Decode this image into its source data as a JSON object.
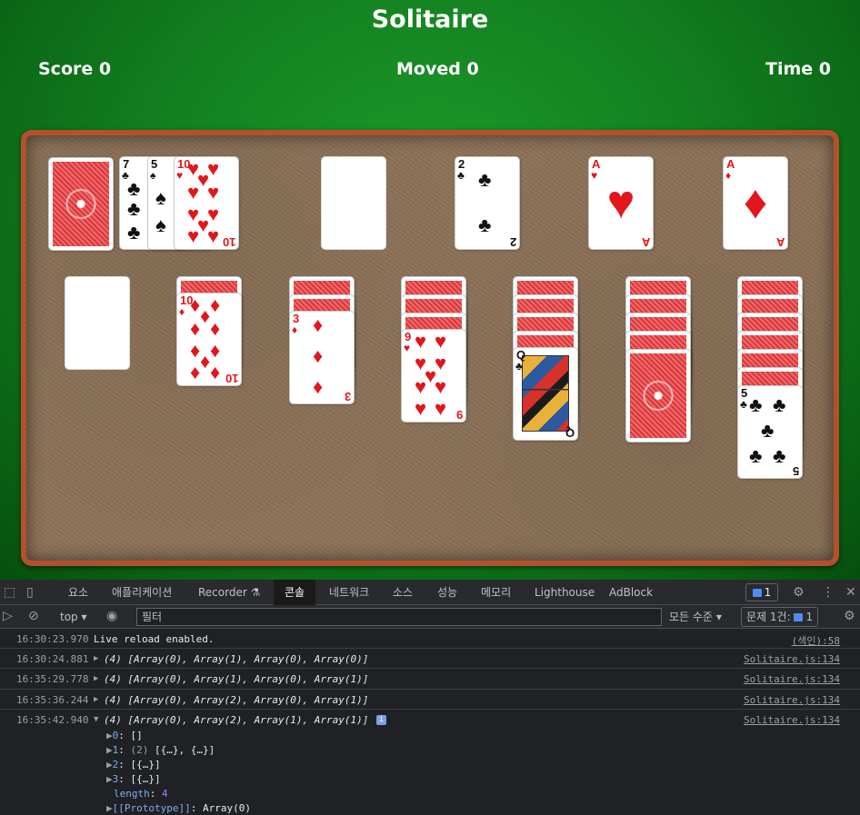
{
  "game": {
    "title": "Solitaire",
    "score_label": "Score 0",
    "moved_label": "Moved 0",
    "time_label": "Time 0"
  },
  "cards": {
    "waste_1": {
      "rank": "7",
      "suit": "♣"
    },
    "waste_2": {
      "rank": "5",
      "suit": "♠"
    },
    "waste_3": {
      "rank": "10",
      "suit": "♥"
    },
    "foundation_clubs": {
      "rank": "2",
      "suit": "♣"
    },
    "foundation_hearts": {
      "rank": "A",
      "suit": "♥"
    },
    "foundation_diamonds": {
      "rank": "A",
      "suit": "♦"
    },
    "tableau_2": {
      "rank": "10",
      "suit": "♦"
    },
    "tableau_3": {
      "rank": "3",
      "suit": "♦"
    },
    "tableau_4": {
      "rank": "9",
      "suit": "♥"
    },
    "tableau_5": {
      "rank": "Q",
      "suit": "♣"
    },
    "tableau_7": {
      "rank": "5",
      "suit": "♣"
    }
  },
  "devtools": {
    "tabs": [
      "요소",
      "애플리케이션",
      "Recorder",
      "콘솔",
      "네트워크",
      "소스",
      "성능",
      "메모리",
      "Lighthouse",
      "AdBlock"
    ],
    "recorder_icon": "flask-icon",
    "issues_count": "1",
    "context": "top",
    "filter_placeholder": "필터",
    "levels": "모든 수준",
    "issues_label": "문제 1건:",
    "issues_label_count": "1",
    "logs": [
      {
        "time": "16:30:23.970",
        "message": "Live reload enabled.",
        "source": "(색인):58"
      },
      {
        "time": "16:30:24.881",
        "message": "(4) [Array(0), Array(1), Array(0), Array(0)]",
        "source": "Solitaire.js:134"
      },
      {
        "time": "16:35:29.778",
        "message": "(4) [Array(0), Array(1), Array(0), Array(1)]",
        "source": "Solitaire.js:134"
      },
      {
        "time": "16:35:36.244",
        "message": "(4) [Array(0), Array(2), Array(0), Array(1)]",
        "source": "Solitaire.js:134"
      },
      {
        "time": "16:35:42.940",
        "message": "(4) [Array(0), Array(2), Array(1), Array(1)]",
        "source": "Solitaire.js:134"
      }
    ],
    "expanded": {
      "k0": "0",
      "v0": "[]",
      "k1": "1",
      "c1": "(2)",
      "v1": "[{…}, {…}]",
      "k2": "2",
      "v2": "[{…}]",
      "k3": "3",
      "v3": "[{…}]",
      "length_key": "length",
      "length_val": "4",
      "proto_key": "[[Prototype]]",
      "proto_val": "Array(0)"
    }
  },
  "colors": {
    "felt": "#138020",
    "board_border": "#b2512b",
    "card_red": "#e2161b",
    "devtools_bg": "#202124",
    "accent_blue": "#4c8df6"
  }
}
